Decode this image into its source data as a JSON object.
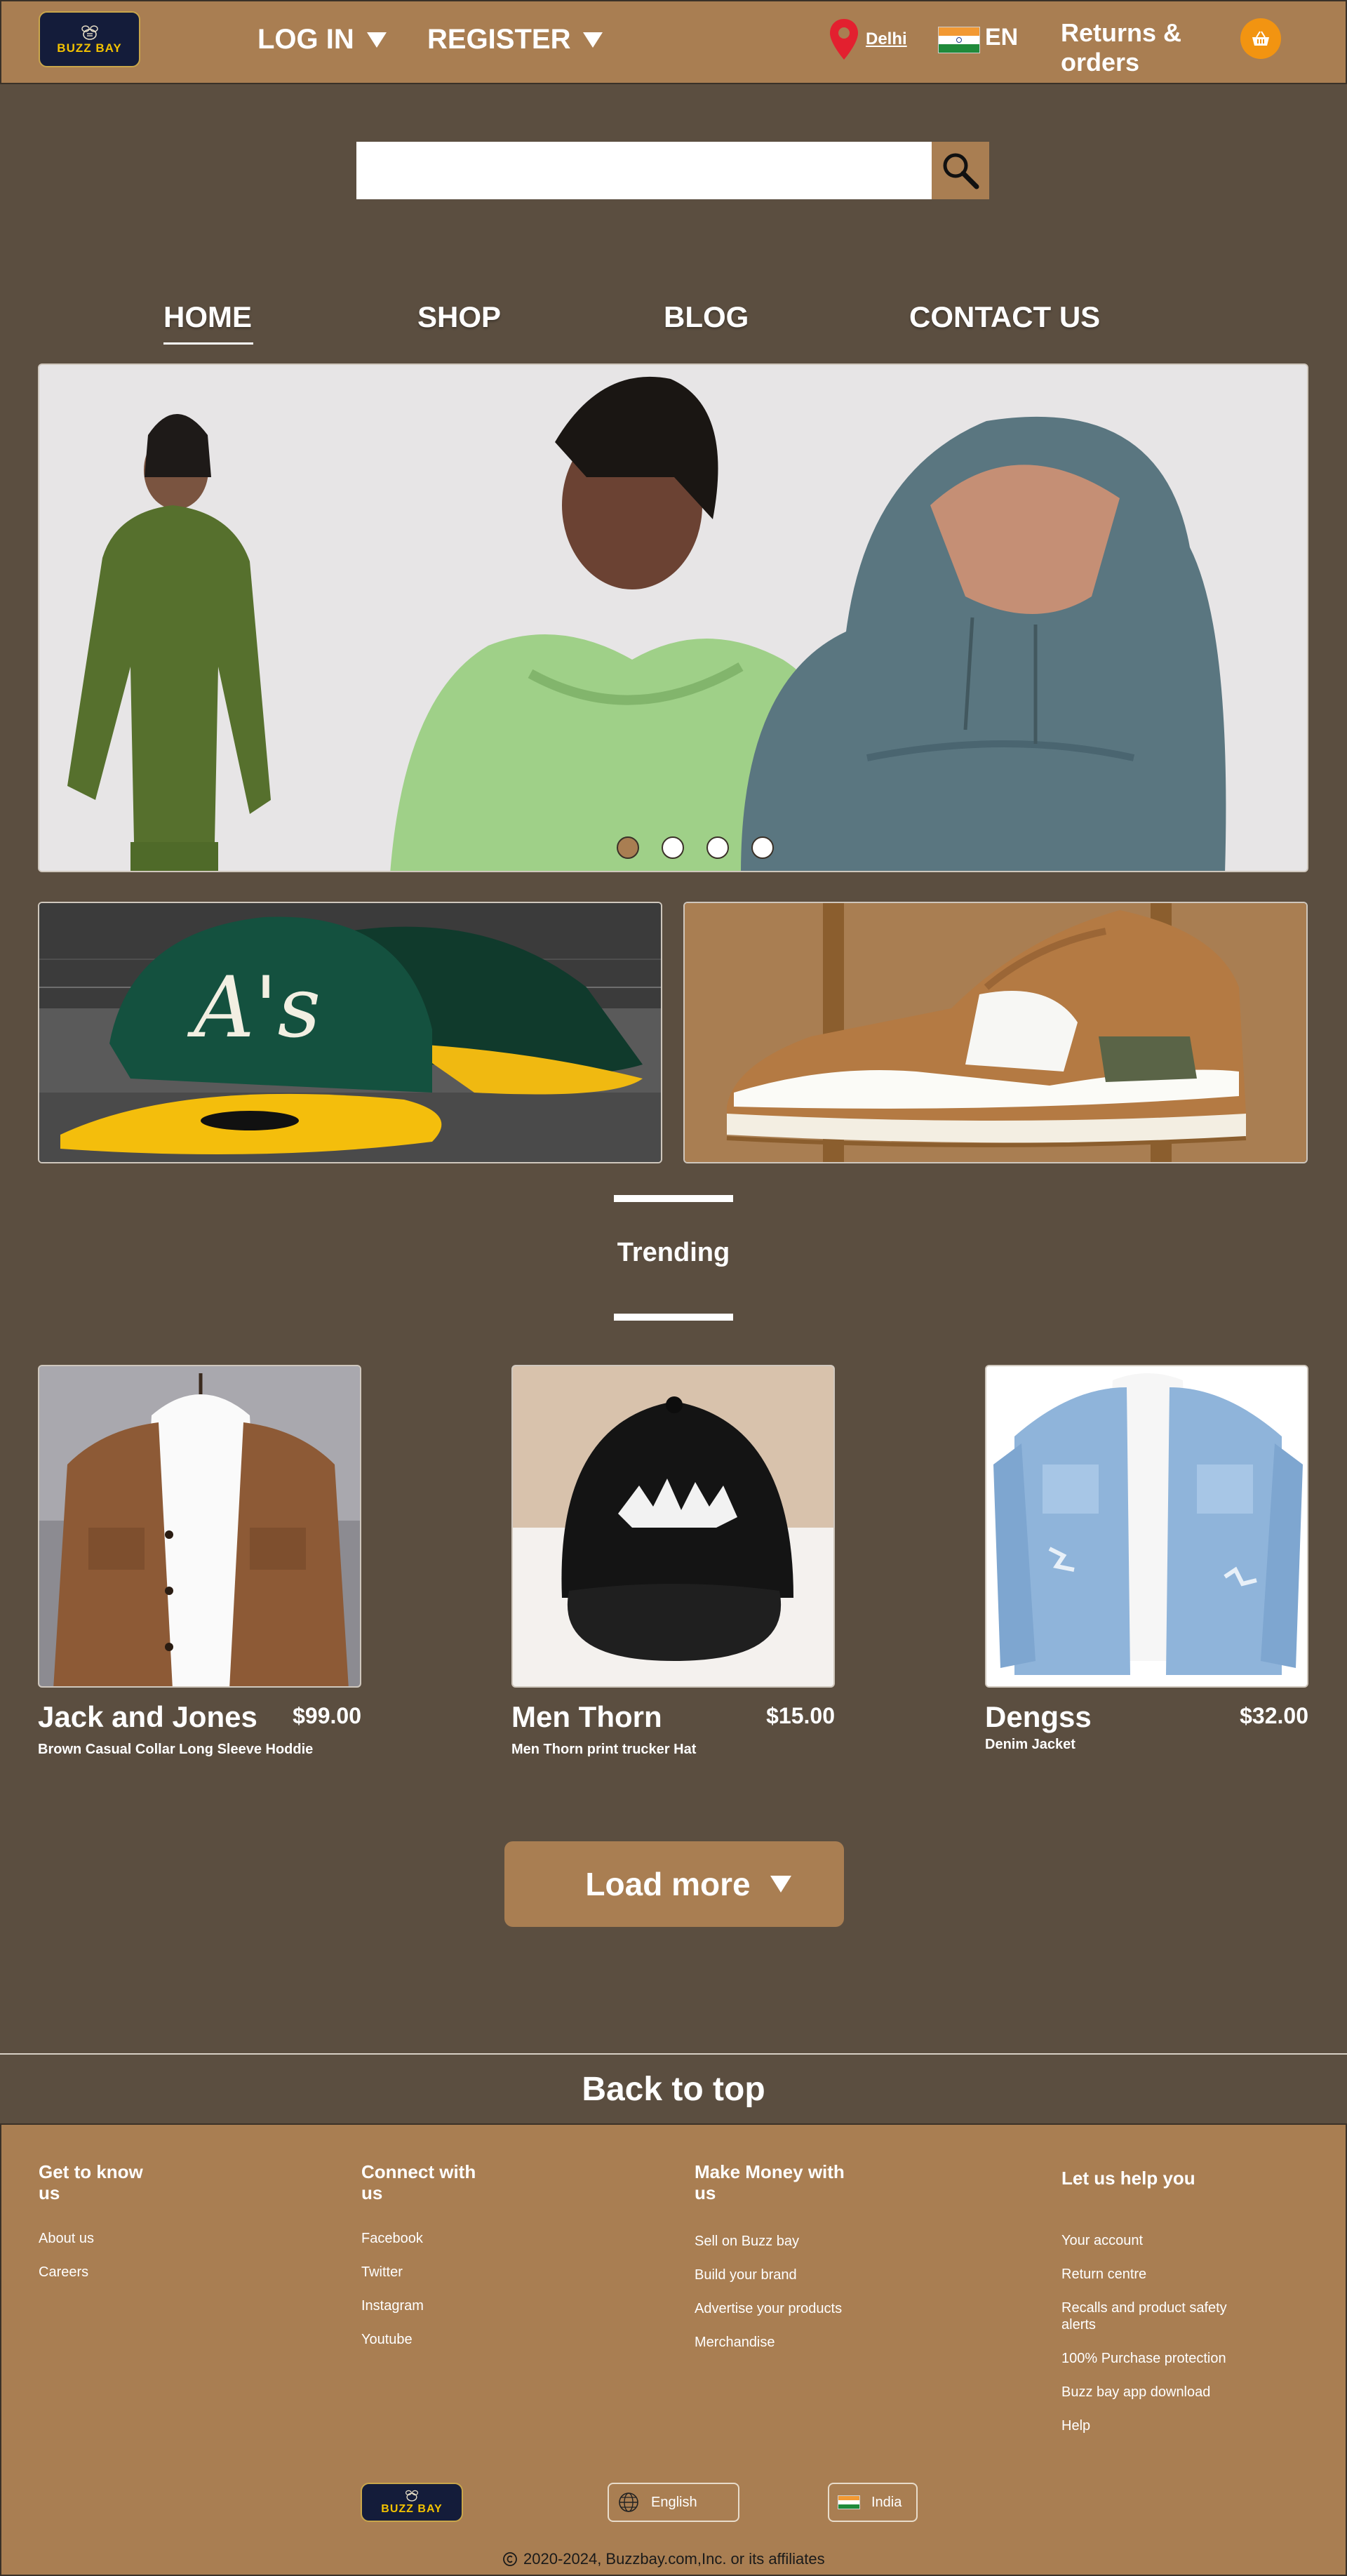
{
  "header": {
    "logo_text": "BUZZ BAY",
    "login_label": "LOG IN",
    "register_label": "REGISTER",
    "location": "Delhi",
    "language": "EN",
    "returns_label": "Returns & orders",
    "cart_icon": "basket-icon"
  },
  "search": {
    "placeholder": "",
    "icon": "search-icon"
  },
  "nav": {
    "items": [
      "HOME",
      "SHOP",
      "BLOG",
      "CONTACT US"
    ],
    "active": "HOME"
  },
  "hero": {
    "slide_count": 4,
    "active_slide": 1
  },
  "trending": {
    "title": "Trending",
    "products": [
      {
        "name": "Jack and Jones",
        "price": "$99.00",
        "description": "Brown Casual Collar Long Sleeve Hoddie"
      },
      {
        "name": "Men Thorn",
        "price": "$15.00",
        "description": "Men Thorn print trucker Hat"
      },
      {
        "name": "Dengss",
        "price": "$32.00",
        "description": "Denim Jacket"
      }
    ],
    "load_more_label": "Load more"
  },
  "back_to_top": "Back to top",
  "footer": {
    "columns": [
      {
        "heading": "Get to know us",
        "links": [
          "About us",
          "Careers"
        ]
      },
      {
        "heading": "Connect with us",
        "links": [
          "Facebook",
          "Twitter",
          "Instagram",
          "Youtube"
        ]
      },
      {
        "heading": "Make Money with us",
        "links": [
          "Sell on Buzz bay",
          "Build your brand",
          "Advertise your products",
          "Merchandise"
        ]
      },
      {
        "heading": "Let us help you",
        "links": [
          "Your account",
          "Return centre",
          "Recalls and product safety alerts",
          "100% Purchase protection",
          "Buzz bay app download",
          "Help"
        ]
      }
    ],
    "logo_text": "BUZZ BAY",
    "language_selector": "English",
    "country_selector": "India",
    "copyright": "2020-2024, Buzzbay.com,Inc. or its affiliates"
  },
  "colors": {
    "accent": "#a97e52",
    "background": "#5b4e40",
    "cart": "#f29411",
    "logo_bg": "#141c3a",
    "logo_text": "#f3c200",
    "pin": "#e3202f"
  }
}
